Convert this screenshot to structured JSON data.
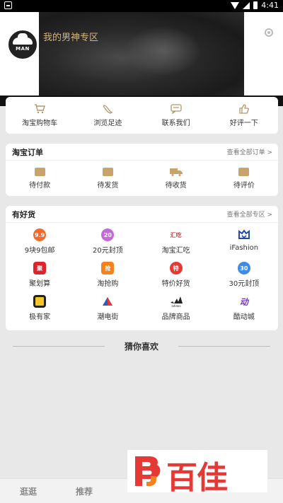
{
  "status": {
    "time": "4:41"
  },
  "header": {
    "avatar_text": "MAN",
    "zone_title": "我的男神专区"
  },
  "quick": [
    {
      "label": "淘宝购物车",
      "icon": "cart-icon"
    },
    {
      "label": "浏览足迹",
      "icon": "footprint-icon"
    },
    {
      "label": "联系我们",
      "icon": "chat-icon"
    },
    {
      "label": "好评一下",
      "icon": "thumbs-up-icon"
    }
  ],
  "orders": {
    "title": "淘宝订单",
    "more": "查看全部订单 >",
    "items": [
      {
        "label": "待付款",
        "icon": "wallet-icon"
      },
      {
        "label": "待发货",
        "icon": "package-icon"
      },
      {
        "label": "待收货",
        "icon": "truck-icon"
      },
      {
        "label": "待评价",
        "icon": "comment-icon"
      }
    ]
  },
  "goods": {
    "title": "有好货",
    "more": "查看全部专区 >",
    "items": [
      {
        "label": "9块9包邮",
        "icon": "9.9-badge-icon",
        "glyph": "9.9",
        "color": "#f56a2a"
      },
      {
        "label": "20元封顶",
        "icon": "20-badge-icon",
        "glyph": "20",
        "color": "#c46ad9"
      },
      {
        "label": "淘宝汇吃",
        "icon": "huichi-logo-icon",
        "glyph": "汇吃",
        "color": "#e53935"
      },
      {
        "label": "iFashion",
        "icon": "ifashion-logo-icon",
        "glyph": "",
        "color": "#1f4aa8"
      },
      {
        "label": "聚划算",
        "icon": "juhuasuan-logo-icon",
        "glyph": "聚",
        "color": "#e0232b"
      },
      {
        "label": "淘抢购",
        "icon": "taoqianggou-logo-icon",
        "glyph": "抢",
        "color": "#f7821b"
      },
      {
        "label": "特价好货",
        "icon": "tejia-logo-icon",
        "glyph": "特",
        "color": "#e53935"
      },
      {
        "label": "30元封顶",
        "icon": "30-badge-icon",
        "glyph": "30",
        "color": "#3d8de8"
      },
      {
        "label": "极有家",
        "icon": "jiyoujia-logo-icon",
        "glyph": "",
        "color": "#222222"
      },
      {
        "label": "潮电街",
        "icon": "chaodianjie-logo-icon",
        "glyph": "",
        "color": "#e53935"
      },
      {
        "label": "品牌商品",
        "icon": "adidas-logo-icon",
        "glyph": "adidas",
        "color": "#222222"
      },
      {
        "label": "酷动城",
        "icon": "kudongcheng-logo-icon",
        "glyph": "动",
        "color": "#7a3cc0"
      }
    ]
  },
  "guess": {
    "title": "猜你喜欢"
  },
  "tabs": {
    "left": "逛逛",
    "middle": "推荐"
  },
  "watermark": {
    "text": "百佳"
  },
  "colors": {
    "gold": "#c8a36c",
    "accent": "#e53935"
  }
}
